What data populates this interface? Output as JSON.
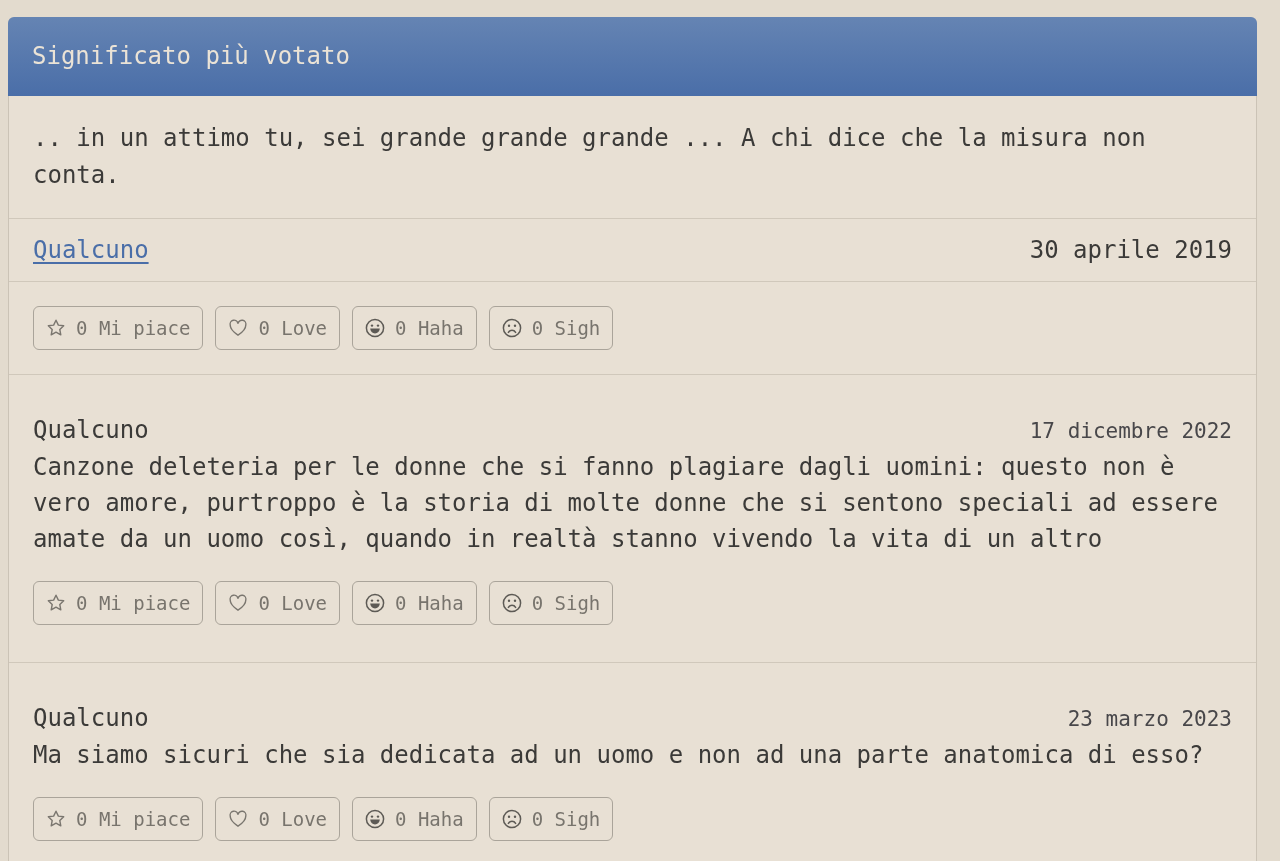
{
  "top_meaning": {
    "title": "Significato più votato",
    "text": ".. in un attimo tu, sei grande grande grande ... A chi dice che la misura non conta.",
    "author": "Qualcuno",
    "date": "30 aprile 2019",
    "reactions": [
      {
        "kind": "like",
        "label": "0 Mi piace"
      },
      {
        "kind": "love",
        "label": "0 Love"
      },
      {
        "kind": "haha",
        "label": "0 Haha"
      },
      {
        "kind": "sigh",
        "label": "0 Sigh"
      }
    ]
  },
  "comments": [
    {
      "author": "Qualcuno",
      "date": "17 dicembre 2022",
      "text": "Canzone deleteria per le donne che si fanno plagiare dagli uomini: questo non è vero amore, purtroppo è la storia di molte donne che si sentono speciali ad essere amate da un uomo così, quando in realtà stanno vivendo la vita di un altro",
      "reactions": [
        {
          "kind": "like",
          "label": "0 Mi piace"
        },
        {
          "kind": "love",
          "label": "0 Love"
        },
        {
          "kind": "haha",
          "label": "0 Haha"
        },
        {
          "kind": "sigh",
          "label": "0 Sigh"
        }
      ]
    },
    {
      "author": "Qualcuno",
      "date": "23 marzo 2023",
      "text": "Ma siamo sicuri che sia dedicata ad un uomo e non ad una parte anatomica di esso?",
      "reactions": [
        {
          "kind": "like",
          "label": "0 Mi piace"
        },
        {
          "kind": "love",
          "label": "0 Love"
        },
        {
          "kind": "haha",
          "label": "0 Haha"
        },
        {
          "kind": "sigh",
          "label": "0 Sigh"
        }
      ]
    }
  ]
}
